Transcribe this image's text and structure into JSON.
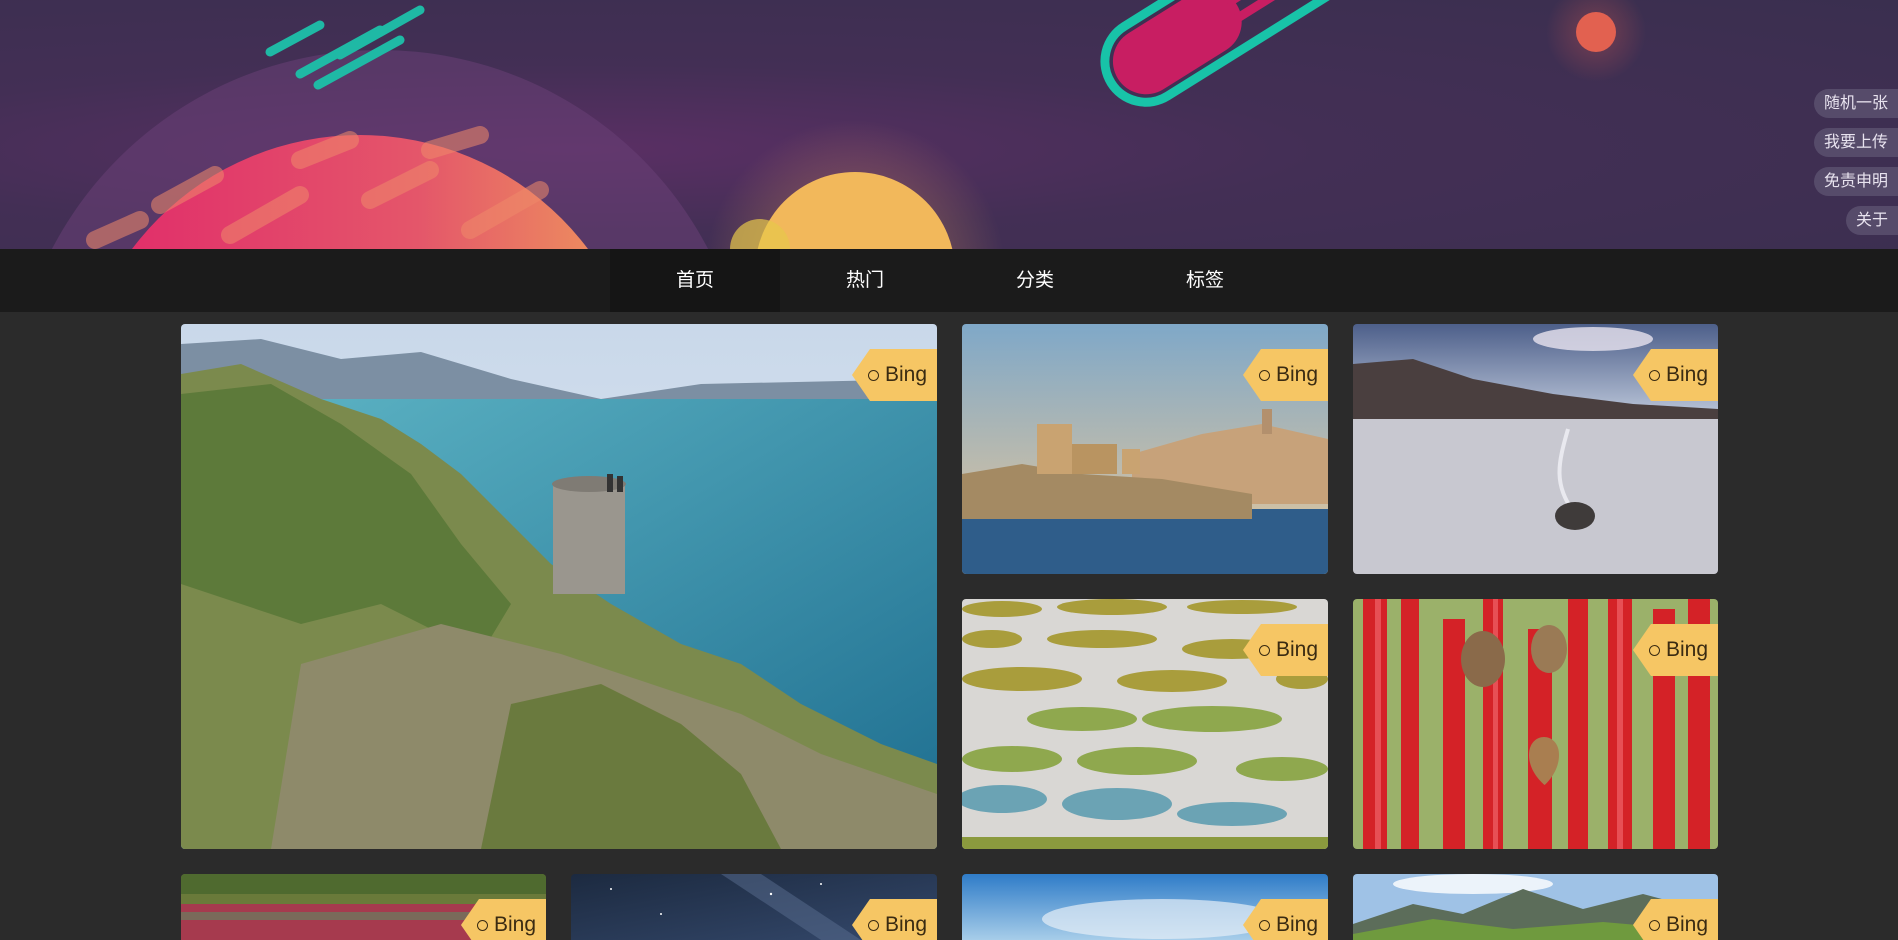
{
  "nav": {
    "items": [
      {
        "label": "首页",
        "active": true
      },
      {
        "label": "热门",
        "active": false
      },
      {
        "label": "分类",
        "active": false
      },
      {
        "label": "标签",
        "active": false
      }
    ]
  },
  "side_buttons": [
    {
      "label": "随机一张"
    },
    {
      "label": "我要上传"
    },
    {
      "label": "免责申明"
    },
    {
      "label": "关于"
    }
  ],
  "gallery": {
    "tag_label": "Bing",
    "tag_icon": "circle-icon",
    "cards": [
      {
        "scene": "coastal-tower-cliff"
      },
      {
        "scene": "island-fortress-city"
      },
      {
        "scene": "desert-sailing-stone"
      },
      {
        "scene": "spotted-lake"
      },
      {
        "scene": "red-ribbons-locks"
      },
      {
        "scene": "red-river-forest"
      },
      {
        "scene": "starry-night-sky"
      },
      {
        "scene": "blue-sky-mountains"
      },
      {
        "scene": "alpine-meadow-peaks"
      }
    ]
  },
  "colors": {
    "nav_bg": "#1b1b1b",
    "page_bg": "#2b2b2b",
    "tag_bg": "#f6c664",
    "banner_bg": "#3f2f52"
  }
}
